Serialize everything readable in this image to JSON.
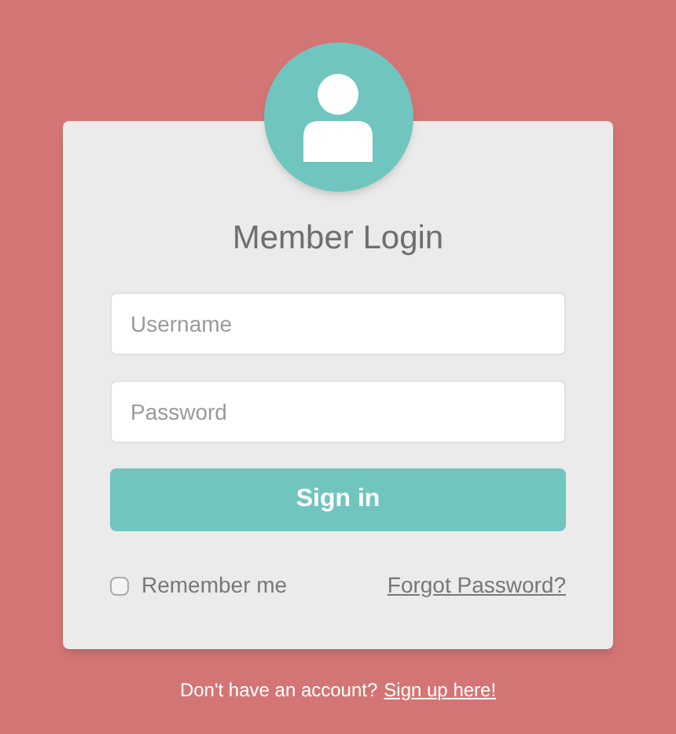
{
  "title": "Member Login",
  "fields": [
    {
      "placeholder": "Username"
    },
    {
      "placeholder": "Password"
    }
  ],
  "submit": "Sign in",
  "remember": {
    "label": "Remember me",
    "checked": false
  },
  "forgot": "Forgot Password?",
  "footer": {
    "text": "Don't have an account?",
    "link": "Sign up here!"
  }
}
